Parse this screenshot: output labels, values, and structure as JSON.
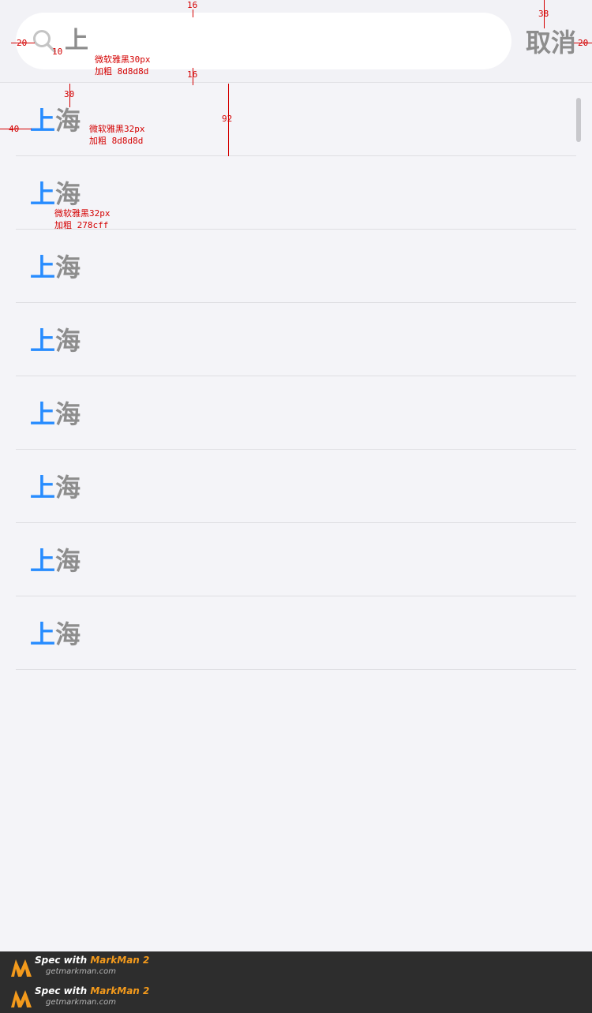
{
  "search": {
    "value": "上",
    "cancel_label": "取消"
  },
  "results": [
    {
      "highlight": "上",
      "rest": "海"
    },
    {
      "highlight": "上",
      "rest": "海"
    },
    {
      "highlight": "上",
      "rest": "海"
    },
    {
      "highlight": "上",
      "rest": "海"
    },
    {
      "highlight": "上",
      "rest": "海"
    },
    {
      "highlight": "上",
      "rest": "海"
    },
    {
      "highlight": "上",
      "rest": "海"
    },
    {
      "highlight": "上",
      "rest": "海"
    }
  ],
  "colors": {
    "highlight": "#278cff",
    "text_gray": "#8d8d8d",
    "background": "#f4f4f8",
    "annotation": "#d40000"
  },
  "annotations": {
    "dim_16_top": "16",
    "dim_16_bottom": "16",
    "dim_38": "38",
    "dim_20_left": "20",
    "dim_20_right": "20",
    "dim_10": "10",
    "dim_30": "30",
    "dim_40": "40",
    "dim_92": "92",
    "input_font": "微软雅黑30px",
    "input_weight": "加粗 8d8d8d",
    "item_font": "微软雅黑32px",
    "item_weight": "加粗 8d8d8d",
    "hl_font": "微软雅黑32px",
    "hl_weight": "加粗 278cff"
  },
  "footer": {
    "badge_prefix": "Spec with ",
    "badge_brand": "MarkMan 2",
    "badge_url": "getmarkman.com"
  }
}
